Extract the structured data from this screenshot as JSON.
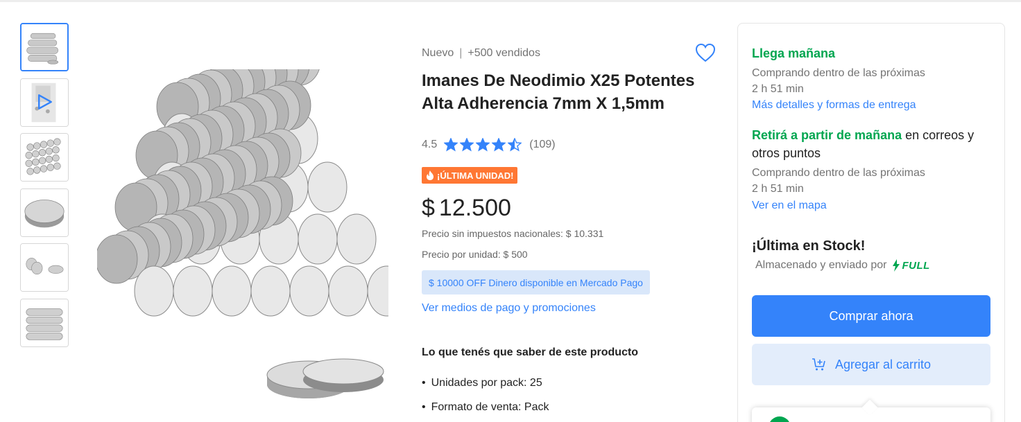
{
  "product": {
    "condition": "Nuevo",
    "sold": "+500 vendidos",
    "title": "Imanes De Neodimio X25 Potentes Alta Adherencia 7mm X 1,5mm",
    "rating": "4.5",
    "rating_value": 4.5,
    "review_count": "(109)",
    "badge": "¡ÚLTIMA UNIDAD!",
    "currency": "$",
    "price": "12.500",
    "price_no_tax": "Precio sin impuestos nacionales: $ 10.331",
    "unit_price": "Precio por unidad: $ 500",
    "promo": "$ 10000 OFF Dinero disponible en Mercado Pago",
    "payment_link": "Ver medios de pago y promociones",
    "know_title": "Lo que tenés que saber de este producto",
    "features": [
      "Unidades por pack: 25",
      "Formato de venta: Pack"
    ]
  },
  "gallery": {
    "thumbnails": [
      "thumb-magnet-stack",
      "thumb-video",
      "thumb-magnet-grid",
      "thumb-magnet-single",
      "thumb-magnet-pair",
      "thumb-magnet-rows"
    ],
    "selected_index": 0
  },
  "shipping": {
    "arrive_title": "Llega mañana",
    "arrive_sub": "Comprando dentro de las próximas",
    "arrive_time": "2 h 51 min",
    "arrive_link": "Más detalles y formas de entrega",
    "pickup_green": "Retirá a partir de mañana",
    "pickup_rest": " en correos y otros puntos",
    "pickup_sub": "Comprando dentro de las próximas",
    "pickup_time": "2 h 51 min",
    "pickup_link": "Ver en el mapa"
  },
  "stock": {
    "title": "¡Última en Stock!",
    "fulfilled_by": "Almacenado y enviado por",
    "full_label": "FULL"
  },
  "actions": {
    "buy_now": "Comprar ahora",
    "add_to_cart": "Agregar al carrito"
  },
  "colors": {
    "accent": "#3483fa",
    "green": "#00a650",
    "badge": "#ff7733"
  }
}
